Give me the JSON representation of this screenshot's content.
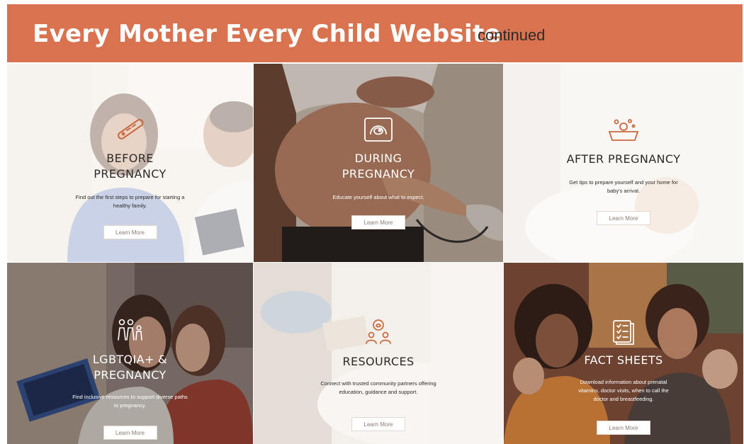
{
  "header": {
    "title": "Every Mother Every Child Website",
    "subtitle": "continued",
    "color": "#d9734f"
  },
  "icon_color": "#c8683c",
  "tiles": [
    {
      "title_line1": "BEFORE",
      "title_line2": "PREGNANCY",
      "description": "Find out the first steps to prepare for starting a healthy family.",
      "button": "Learn More",
      "icon": "pregnancy-test-icon"
    },
    {
      "title_line1": "DURING",
      "title_line2": "PREGNANCY",
      "description": "Educate yourself about what to expect.",
      "button": "Learn More",
      "icon": "ultrasound-icon"
    },
    {
      "title_line1": "AFTER PREGNANCY",
      "title_line2": "",
      "description": "Get tips to prepare yourself and your home for baby's arrival.",
      "button": "Learn More",
      "icon": "baby-bath-icon"
    },
    {
      "title_line1": "LGBTQIA+ &",
      "title_line2": "PREGNANCY",
      "description": "Find inclusive resources to support diverse paths to pregnancy.",
      "button": "Learn More",
      "icon": "family-icon"
    },
    {
      "title_line1": "RESOURCES",
      "title_line2": "",
      "description": "Connect with trusted community partners offering education, guidance and support.",
      "button": "Learn More",
      "icon": "community-icon"
    },
    {
      "title_line1": "FACT SHEETS",
      "title_line2": "",
      "description": "Download information about prenatal vitamins, doctor visits, when to call the doctor and breastfeeding.",
      "button": "Learn More",
      "icon": "checklist-icon"
    }
  ]
}
